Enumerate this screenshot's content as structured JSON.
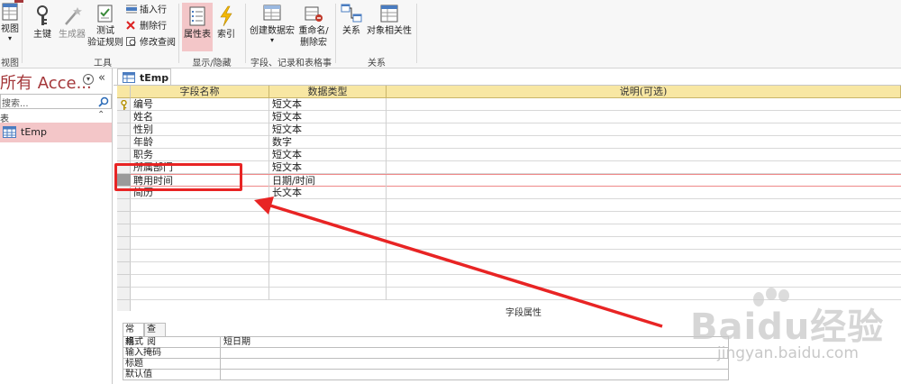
{
  "ribbon": {
    "view_label": "视图",
    "view_group_label": "视图",
    "primary_key_label": "主键",
    "builder_label": "生成器",
    "test_rules_label_1": "测试",
    "test_rules_label_2": "验证规则",
    "insert_row_label": "插入行",
    "delete_row_label": "删除行",
    "modify_lookup_label": "修改查阅",
    "tools_group_label": "工具",
    "property_sheet_label": "属性表",
    "index_label": "索引",
    "showhide_group_label": "显示/隐藏",
    "create_macro_label": "创建数据宏",
    "rename_macro_label_1": "重命名/",
    "rename_macro_label_2": "删除宏",
    "events_group_label": "字段、记录和表格事件",
    "relationships_label": "关系",
    "object_dependencies_label": "对象相关性",
    "relationships_group_label": "关系"
  },
  "nav": {
    "title": "所有 Acce...",
    "search_placeholder": "搜索...",
    "section_label": "表",
    "item_label": "tEmp"
  },
  "document": {
    "tab_label": "tEmp",
    "columns": [
      "字段名称",
      "数据类型",
      "说明(可选)"
    ],
    "rows": [
      {
        "name": "编号",
        "type": "短文本",
        "primary_key": true
      },
      {
        "name": "姓名",
        "type": "短文本"
      },
      {
        "name": "性别",
        "type": "短文本"
      },
      {
        "name": "年龄",
        "type": "数字"
      },
      {
        "name": "职务",
        "type": "短文本"
      },
      {
        "name": "所属部门",
        "type": "短文本"
      },
      {
        "name": "聘用时间",
        "type": "日期/时间",
        "selected": true
      },
      {
        "name": "简历",
        "type": "长文本"
      }
    ],
    "field_properties_label": "字段属性",
    "property_tabs": [
      "常规",
      "查阅"
    ],
    "properties": [
      {
        "label": "格式",
        "value": "短日期"
      },
      {
        "label": "输入掩码",
        "value": ""
      },
      {
        "label": "标题",
        "value": ""
      },
      {
        "label": "默认值",
        "value": ""
      }
    ]
  },
  "watermark": {
    "brand": "Baidu经验",
    "url": "jingyan.baidu.com"
  },
  "colors": {
    "accent": "#a4373a",
    "header_fill": "#f8e7a3",
    "annotation_red": "#e82424",
    "nav_selected": "#f3c6c8"
  }
}
